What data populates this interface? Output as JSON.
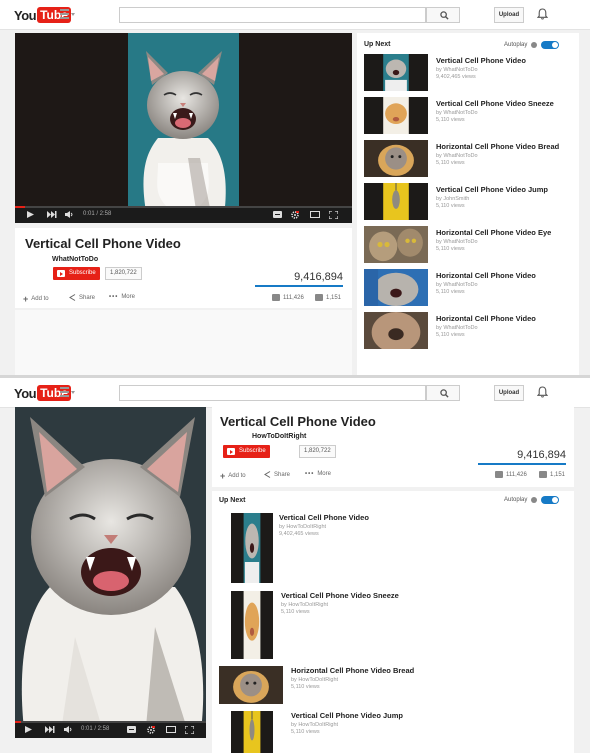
{
  "app": {
    "logo_you": "You",
    "logo_tube": "Tube"
  },
  "masthead": {
    "search_placeholder": "",
    "upload_label": "Upload"
  },
  "colors": {
    "brand_red": "#e62117",
    "accent_blue": "#167ac6"
  },
  "panel1": {
    "video_title": "Vertical Cell Phone Video",
    "channel_name": "WhatNotToDo",
    "subscribe_label": "Subscribe",
    "subscriber_count": "1,820,722",
    "view_count": "9,416,894",
    "time_display": "0:01 / 2:58",
    "actions": {
      "add_to": "Add to",
      "share": "Share",
      "more": "More"
    },
    "likes": "111,426",
    "dislikes": "1,151",
    "upnext_label": "Up Next",
    "autoplay_label": "Autoplay",
    "items": [
      {
        "title": "Vertical Cell Phone Video",
        "by": "by WhatNotToDo",
        "views": "9,402,465 views"
      },
      {
        "title": "Vertical Cell Phone Video Sneeze",
        "by": "by WhatNotToDo",
        "views": "5,110 views"
      },
      {
        "title": "Horizontal Cell Phone Video Bread",
        "by": "by WhatNotToDo",
        "views": "5,110 views"
      },
      {
        "title": "Vertical Cell Phone Video Jump",
        "by": "by JohnSmith",
        "views": "5,110 views"
      },
      {
        "title": "Horizontal Cell Phone Video Eye",
        "by": "by WhatNotToDo",
        "views": "5,110 views"
      },
      {
        "title": "Horizontal Cell Phone Video",
        "by": "by WhatNotToDo",
        "views": "5,110 views"
      },
      {
        "title": "Horizontal Cell Phone Video",
        "by": "by WhatNotToDo",
        "views": "5,110 views"
      }
    ]
  },
  "panel2": {
    "video_title": "Vertical Cell Phone Video",
    "channel_name": "HowToDoItRight",
    "subscribe_label": "Subscribe",
    "subscriber_count": "1,820,722",
    "view_count": "9,416,894",
    "time_display": "0:01 / 2:58",
    "actions": {
      "add_to": "Add to",
      "share": "Share",
      "more": "More"
    },
    "likes": "111,426",
    "dislikes": "1,151",
    "upnext_label": "Up Next",
    "autoplay_label": "Autoplay",
    "items": [
      {
        "title": "Vertical Cell Phone Video",
        "by": "by HowToDoItRight",
        "views": "9,402,465 views"
      },
      {
        "title": "Vertical Cell Phone Video Sneeze",
        "by": "by HowToDoItRight",
        "views": "5,110 views"
      },
      {
        "title": "Horizontal Cell Phone Video Bread",
        "by": "by HowToDoItRight",
        "views": "5,110 views"
      },
      {
        "title": "Vertical Cell Phone Video Jump",
        "by": "by HowToDoItRight",
        "views": "5,110 views"
      }
    ]
  }
}
